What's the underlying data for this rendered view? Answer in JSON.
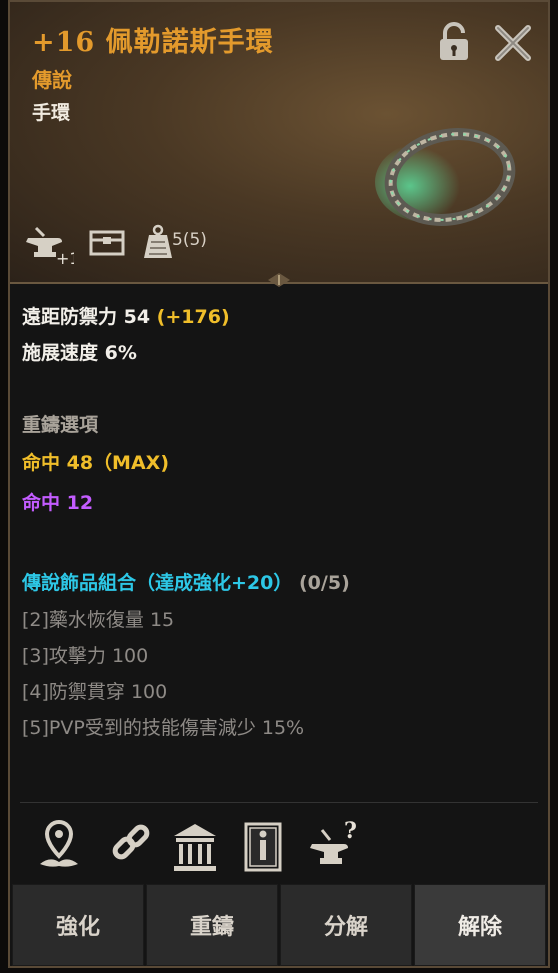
{
  "item": {
    "title": "+16  佩勒諾斯手環",
    "grade": "傳說",
    "type": "手環",
    "stack_count": "5(5)"
  },
  "icons": {
    "lock": "lock-icon",
    "close": "close-icon",
    "enhance": "anvil-plus-icon",
    "storage": "chest-icon",
    "weight": "weight-icon"
  },
  "stats": {
    "ranged_def_label": "遠距防禦力 54",
    "ranged_def_bonus": " (+176)",
    "cast_speed": "施展速度 6%"
  },
  "reforge": {
    "heading": "重鑄選項",
    "opt1": "命中 48（MAX)",
    "opt2": "命中 12"
  },
  "set": {
    "heading": "傳說飾品組合（達成強化+20）",
    "progress": "(0/5)",
    "bonuses": [
      "[2]藥水恢復量 15",
      "[3]攻擊力 100",
      "[4]防禦貫穿 100",
      "[5]PVP受到的技能傷害減少 15%"
    ]
  },
  "action_icons": [
    "map-pin-icon",
    "link-icon",
    "bank-icon",
    "info-book-icon",
    "anvil-help-icon"
  ],
  "buttons": {
    "enhance": "強化",
    "reforge": "重鑄",
    "decompose": "分解",
    "release": "解除"
  },
  "colors": {
    "title": "#e39a2c",
    "gold": "#f0be2a",
    "purple": "#c35cff",
    "cyan": "#2dc7e6"
  }
}
